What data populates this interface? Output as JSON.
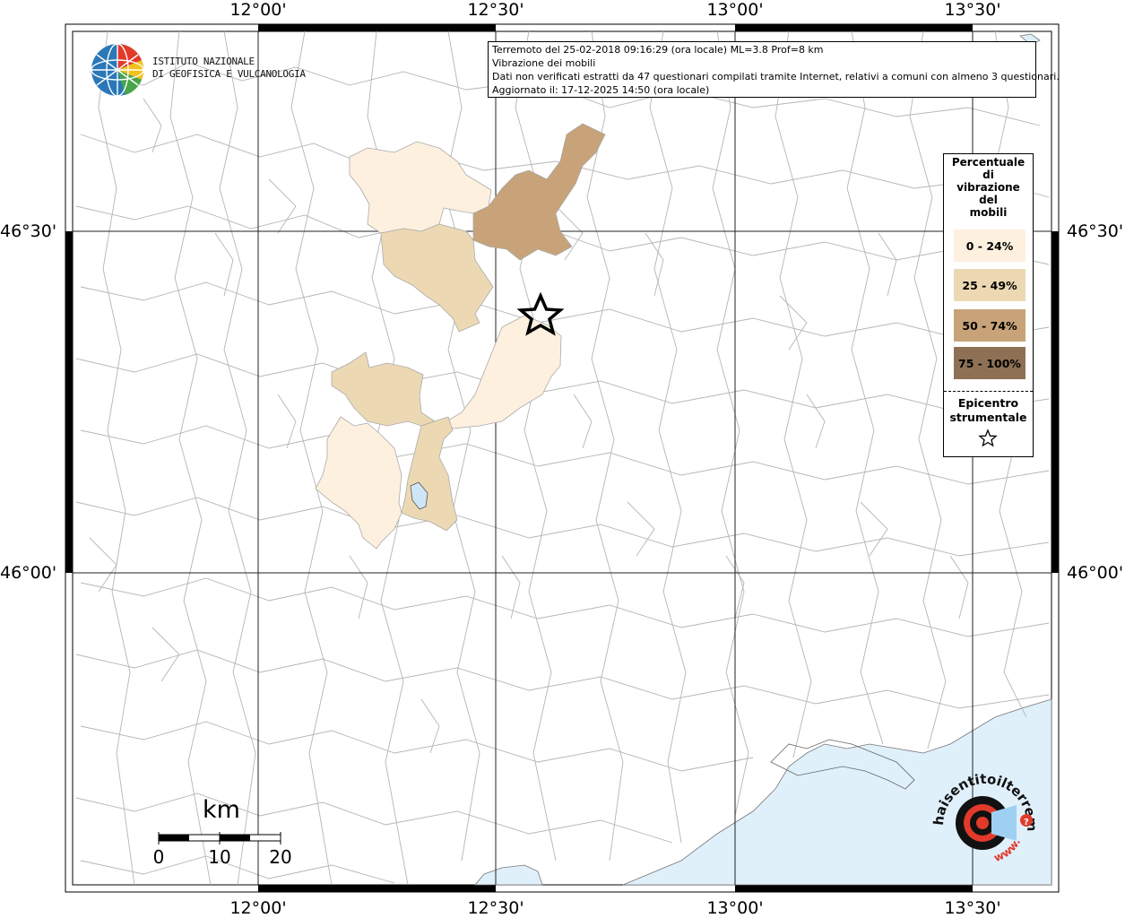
{
  "map": {
    "lon_ticks": [
      "12°00'",
      "12°30'",
      "13°00'",
      "13°30'"
    ],
    "lat_ticks": [
      "46°30'",
      "46°00'"
    ]
  },
  "info": {
    "line1": "Terremoto del 25-02-2018 09:16:29 (ora locale) ML=3.8 Prof=8 km",
    "line2": "Vibrazione dei mobili",
    "line3": "Dati non verificati estratti da 47 questionari compilati tramite Internet, relativi a comuni con almeno 3 questionari.",
    "line4": "Aggiornato il: 17-12-2025 14:50 (ora locale)"
  },
  "legend": {
    "title_lines": [
      "Percentuale",
      "di",
      "vibrazione",
      "del",
      "mobili"
    ],
    "classes": [
      {
        "label": "0 - 24%",
        "color": "#fdf0df"
      },
      {
        "label": "25 - 49%",
        "color": "#ecd9b4"
      },
      {
        "label": "50 - 74%",
        "color": "#c8a379"
      },
      {
        "label": "75 - 100%",
        "color": "#8e7154"
      }
    ],
    "epicenter_label_1": "Epicentro",
    "epicenter_label_2": "strumentale"
  },
  "institute": {
    "line1": "ISTITUTO NAZIONALE",
    "line2": "DI GEOFISICA E VULCANOLOGIA"
  },
  "scale": {
    "unit": "km",
    "labels": [
      "0",
      "10",
      "20"
    ]
  },
  "brand": {
    "text": "haisentitoilterremoto.it",
    "www": "www."
  },
  "colors": {
    "sea": "#dff0fb",
    "border": "#aaaaaa",
    "grid": "#222222"
  }
}
